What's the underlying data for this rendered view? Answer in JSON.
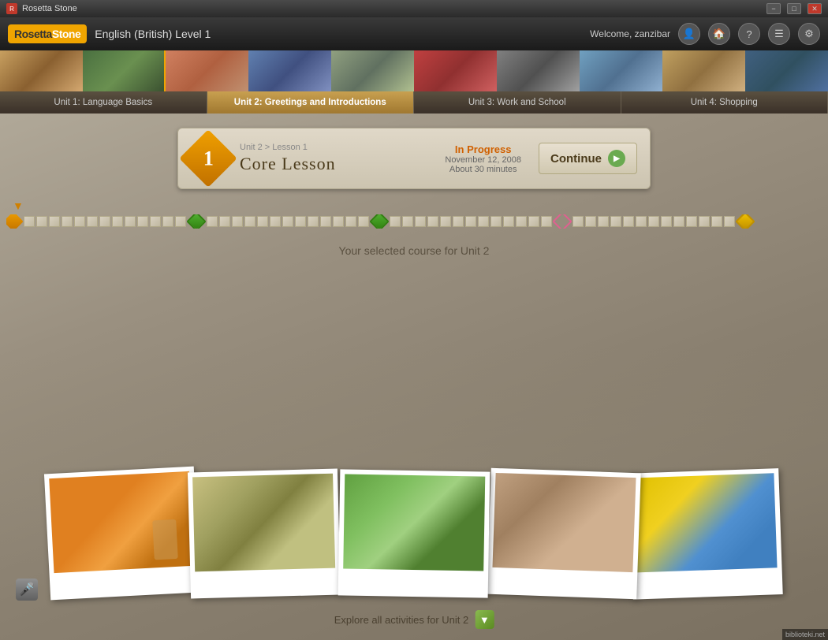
{
  "app": {
    "title": "Rosetta Stone",
    "logo_first": "Rosetta",
    "logo_second": "Stone"
  },
  "titlebar": {
    "title": "Rosetta Stone",
    "minimize_label": "−",
    "maximize_label": "□",
    "close_label": "✕"
  },
  "header": {
    "logo": "RosettaStone",
    "course_title": "English (British) Level 1",
    "welcome_text": "Welcome, zanzibar"
  },
  "units": [
    {
      "id": "unit1",
      "label": "Unit 1: Language Basics",
      "active": false
    },
    {
      "id": "unit2",
      "label": "Unit 2: Greetings and Introductions",
      "active": true
    },
    {
      "id": "unit3",
      "label": "Unit 3: Work and School",
      "active": false
    },
    {
      "id": "unit4",
      "label": "Unit 4: Shopping",
      "active": false
    }
  ],
  "lesson_card": {
    "number": "1",
    "breadcrumb": "Unit 2 > Lesson 1",
    "title": "Core Lesson",
    "status": "In Progress",
    "date": "November 12, 2008",
    "duration": "About 30 minutes",
    "continue_label": "Continue"
  },
  "selected_course_text": "Your selected course for Unit 2",
  "explore_text": "Explore all activities for Unit 2",
  "watermark": "biblioteki.net"
}
